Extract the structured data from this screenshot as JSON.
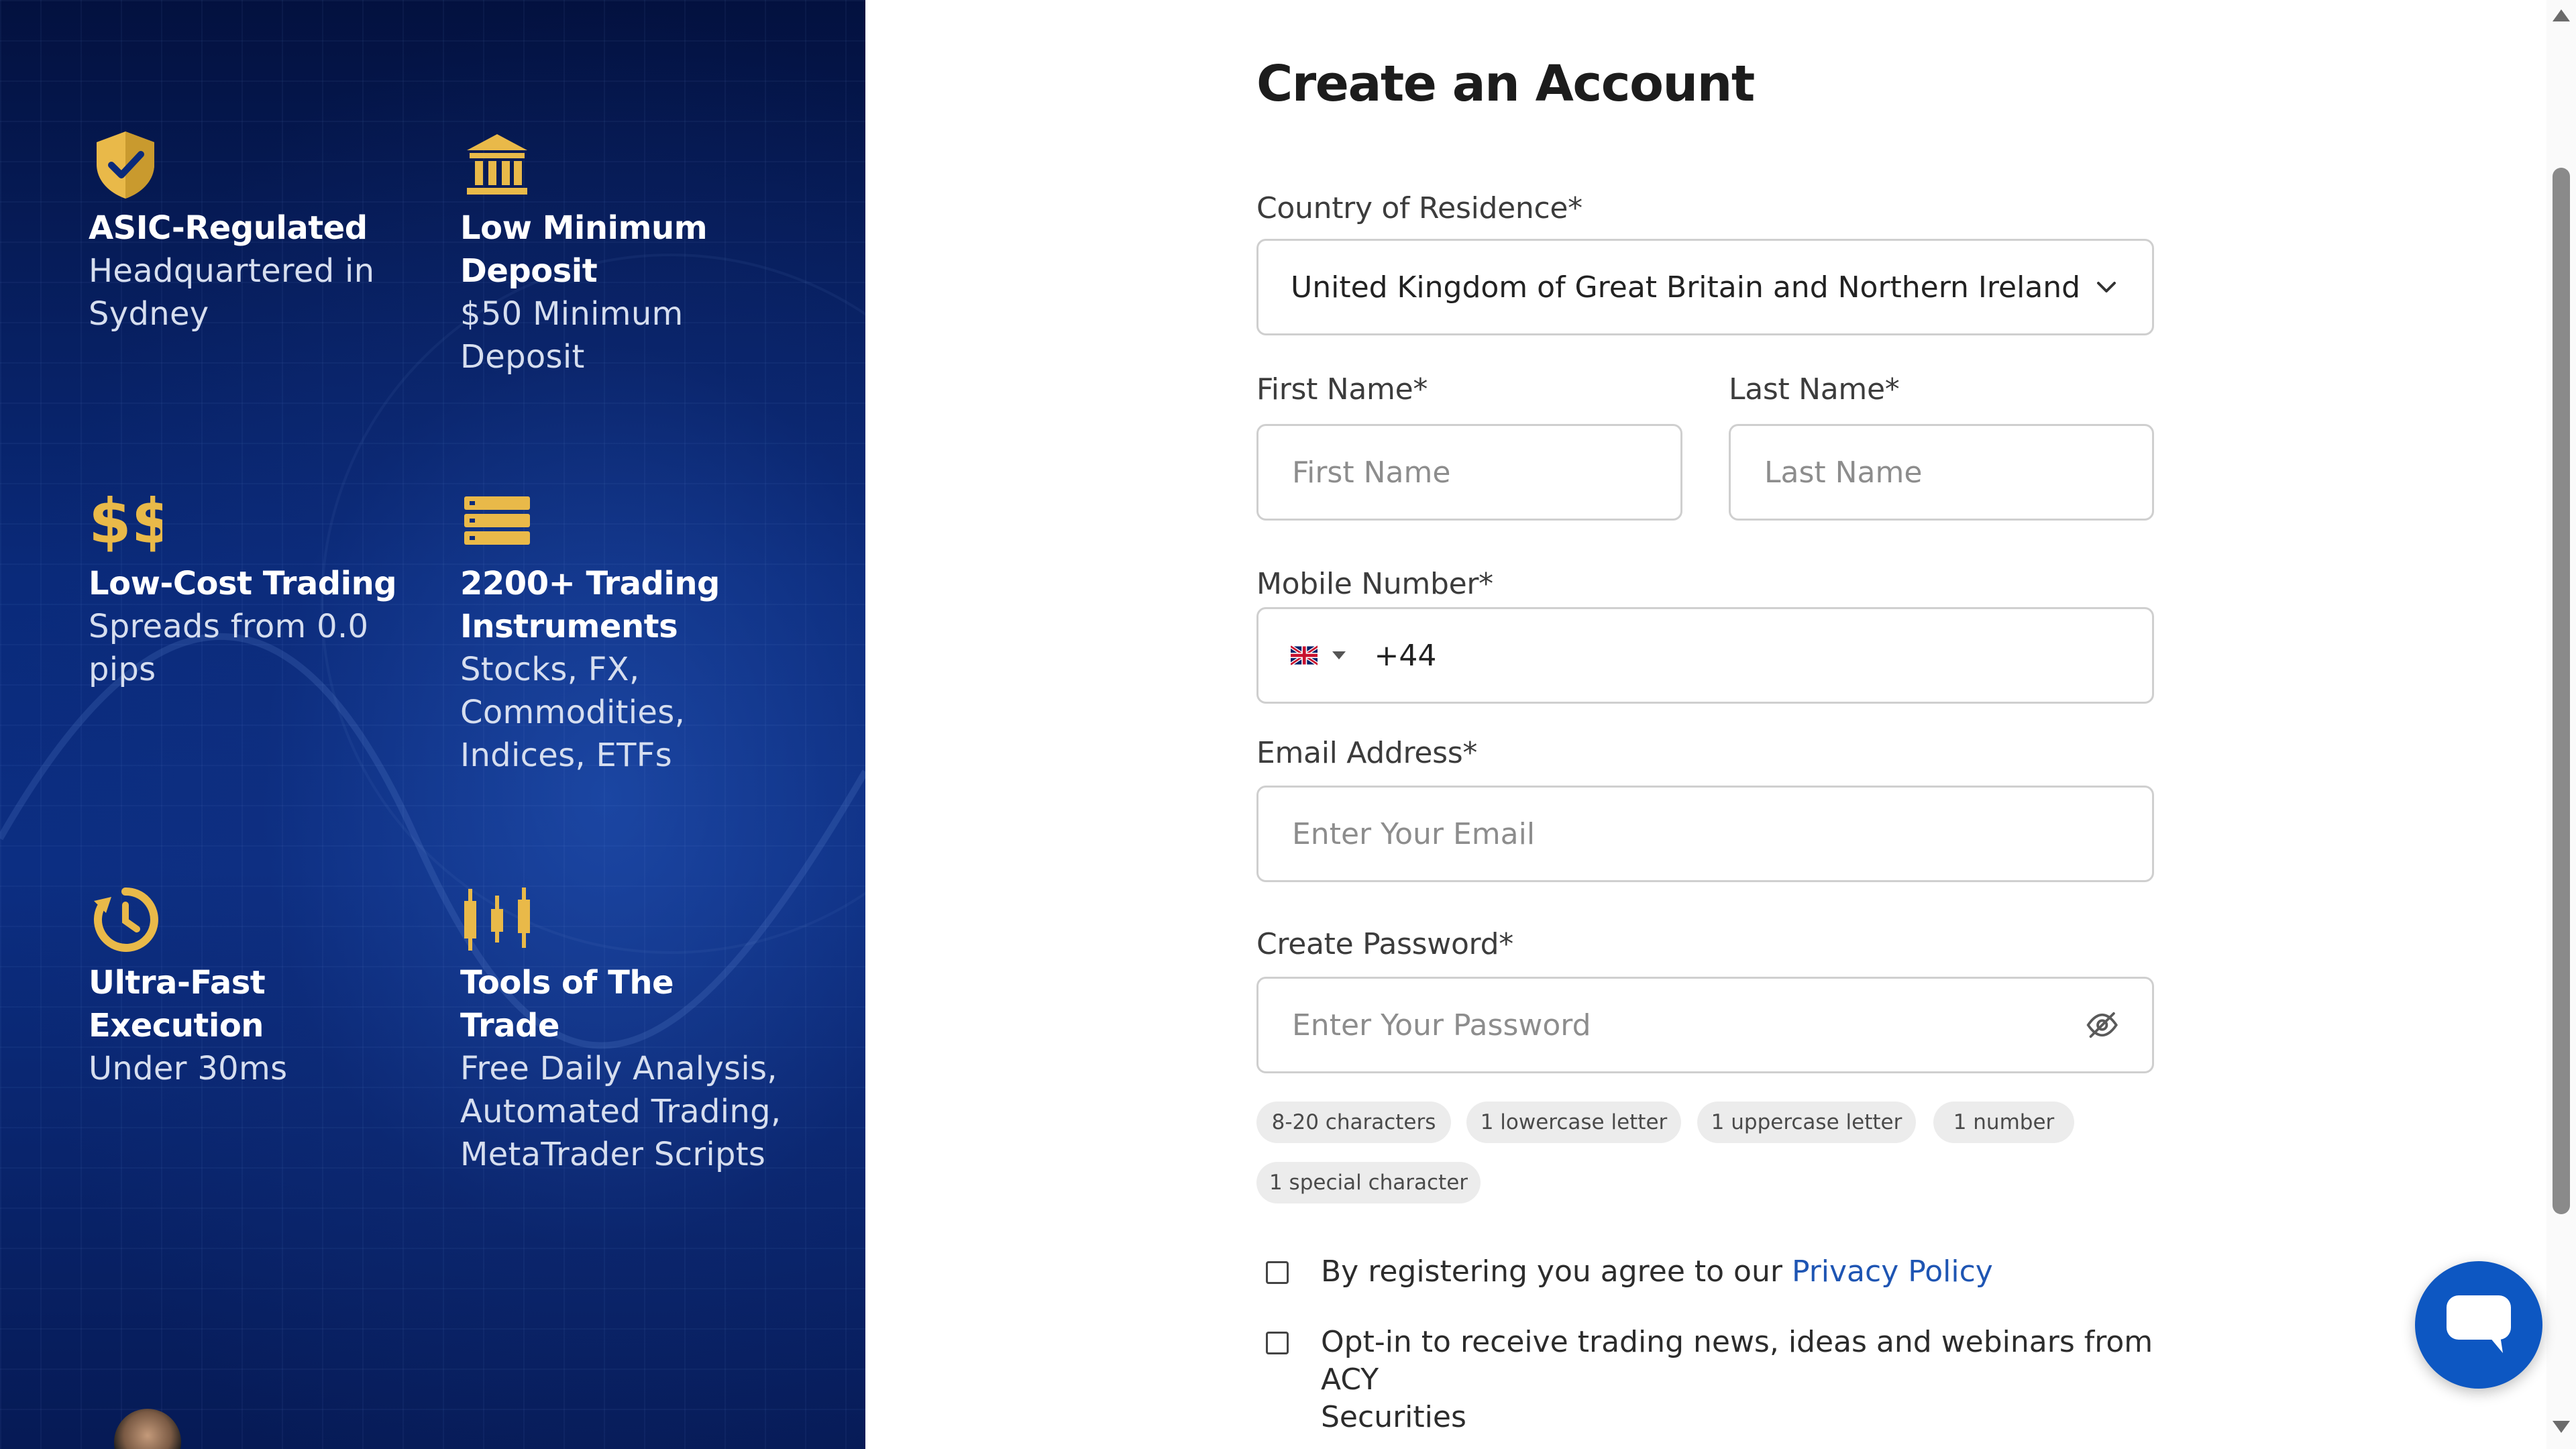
{
  "features": [
    {
      "icon": "shield-check-icon",
      "title": "ASIC-Regulated",
      "subtitle": "Headquartered in Sydney"
    },
    {
      "icon": "bank-icon",
      "title": "Low Minimum Deposit",
      "subtitle": "$50 Minimum Deposit"
    },
    {
      "icon": "dollar-signs-icon",
      "title": "Low-Cost Trading",
      "subtitle": "Spreads from 0.0 pips"
    },
    {
      "icon": "server-stack-icon",
      "title": "2200+ Trading Instruments",
      "subtitle": "Stocks, FX, Commodities, Indices, ETFs"
    },
    {
      "icon": "clock-icon",
      "title": "Ultra-Fast Execution",
      "subtitle": "Under 30ms"
    },
    {
      "icon": "candlestick-icon",
      "title": "Tools of The Trade",
      "subtitle": "Free Daily Analysis, Automated Trading, MetaTrader Scripts"
    }
  ],
  "form": {
    "title": "Create an Account",
    "country": {
      "label": "Country of Residence*",
      "value": "United Kingdom of Great Britain and Northern Ireland"
    },
    "first_name": {
      "label": "First Name*",
      "placeholder": "First Name"
    },
    "last_name": {
      "label": "Last Name*",
      "placeholder": "Last Name"
    },
    "mobile": {
      "label": "Mobile Number*",
      "dial_code": "+44",
      "flag": "uk-flag-icon"
    },
    "email": {
      "label": "Email Address*",
      "placeholder": "Enter Your Email"
    },
    "password": {
      "label": "Create Password*",
      "placeholder": "Enter Your Password"
    },
    "password_rules": [
      "8-20 characters",
      "1 lowercase letter",
      "1 uppercase letter",
      "1 number",
      "1 special character"
    ],
    "privacy": {
      "text": "By registering you agree to our ",
      "link": "Privacy Policy",
      "checked": false
    },
    "optin": {
      "line1": "Opt-in to receive trading news, ideas and webinars from ACY",
      "line2": "Securities",
      "checked": false
    }
  },
  "colors": {
    "accent": "#1e55b3",
    "icon_gold": "#e9b949",
    "panel_dark": "#03113f",
    "chat": "#0d57c2"
  }
}
